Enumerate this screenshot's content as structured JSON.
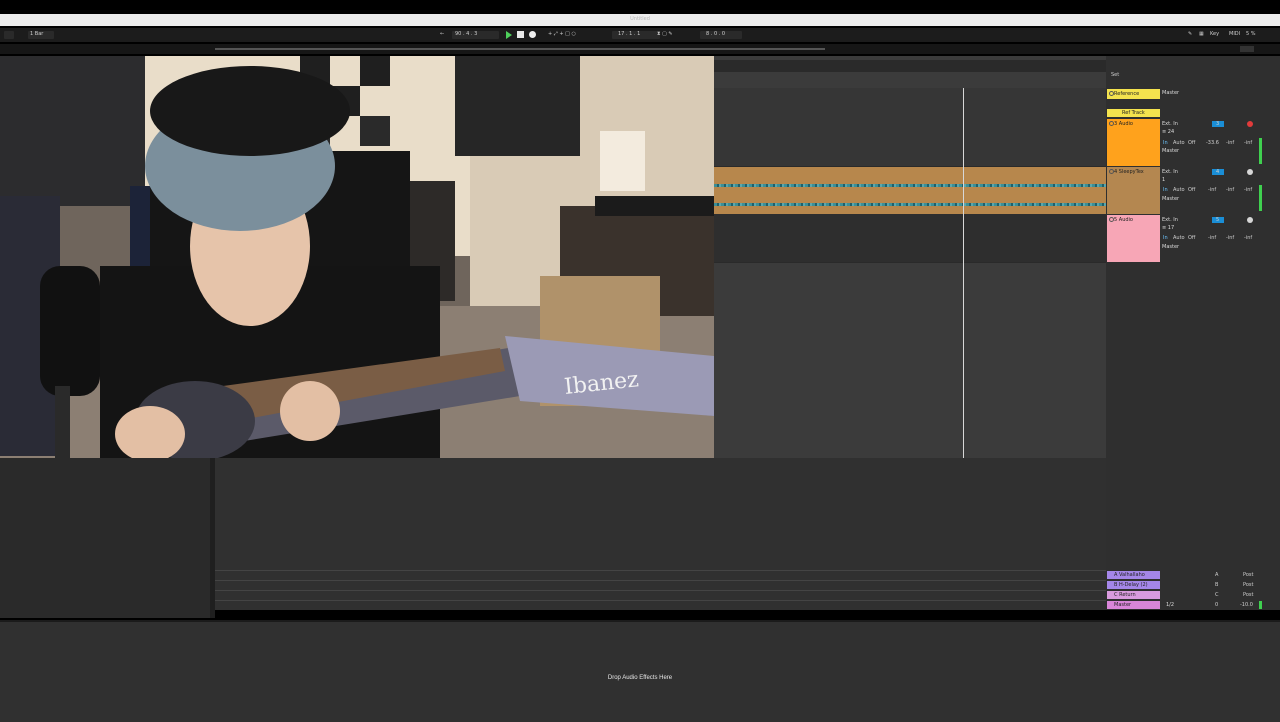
{
  "window": {
    "title": "Untitled"
  },
  "control_bar": {
    "quantize": "1 Bar",
    "tempo": "90 . 4 . 3",
    "position": "17 . 1 . 1",
    "end_position": "8 . 0 . 0",
    "key_label": "Key",
    "midi_label": "MIDI",
    "cpu": "5 %"
  },
  "tracks": [
    {
      "name": "Reference",
      "color": "#f4e34e",
      "io": "Master"
    },
    {
      "name": "Ref Track",
      "color": "#f4e34e",
      "io": ""
    },
    {
      "name": "3 Audio",
      "color": "#ffa21c",
      "input": "Ext. In",
      "channel": "≡ 24",
      "monitor": [
        "In",
        "Auto",
        "Off"
      ],
      "output": "Master",
      "volume": "-33.6",
      "send_a": "-inf",
      "send_b": "-inf",
      "num": "3"
    },
    {
      "name": "4 SleepyTex",
      "color": "#b48750",
      "input": "Ext. In",
      "channel": "1",
      "monitor": [
        "In",
        "Auto",
        "Off"
      ],
      "output": "Master",
      "volume": "-inf",
      "send_a": "-inf",
      "send_b": "-inf",
      "num": "4"
    },
    {
      "name": "5 Audio",
      "color": "#f7a6b6",
      "input": "Ext. In",
      "channel": "≡ 17",
      "monitor": [
        "In",
        "Auto",
        "Off"
      ],
      "output": "Master",
      "volume": "-inf",
      "send_a": "-inf",
      "send_b": "-inf",
      "num": "5"
    }
  ],
  "returns": [
    {
      "name": "A Valhallaho",
      "color": "#a486e8",
      "letter": "A",
      "post": "Post"
    },
    {
      "name": "B H-Delay (2)",
      "color": "#a486e8",
      "letter": "B",
      "post": "Post"
    },
    {
      "name": "C Return",
      "color": "#d99bde",
      "letter": "C",
      "post": "Post"
    },
    {
      "name": "Master",
      "color": "#d986d9",
      "io": "1/2",
      "num": "0",
      "volume": "-10.0"
    }
  ],
  "set_label": "Set",
  "detail": {
    "drop_text": "Drop Audio Effects Here"
  },
  "video": {
    "guitar_brand": "Ibanez"
  },
  "colors": {
    "accent_play": "#4ed05b",
    "meter_green": "#3fd04f",
    "background": "#303030"
  }
}
